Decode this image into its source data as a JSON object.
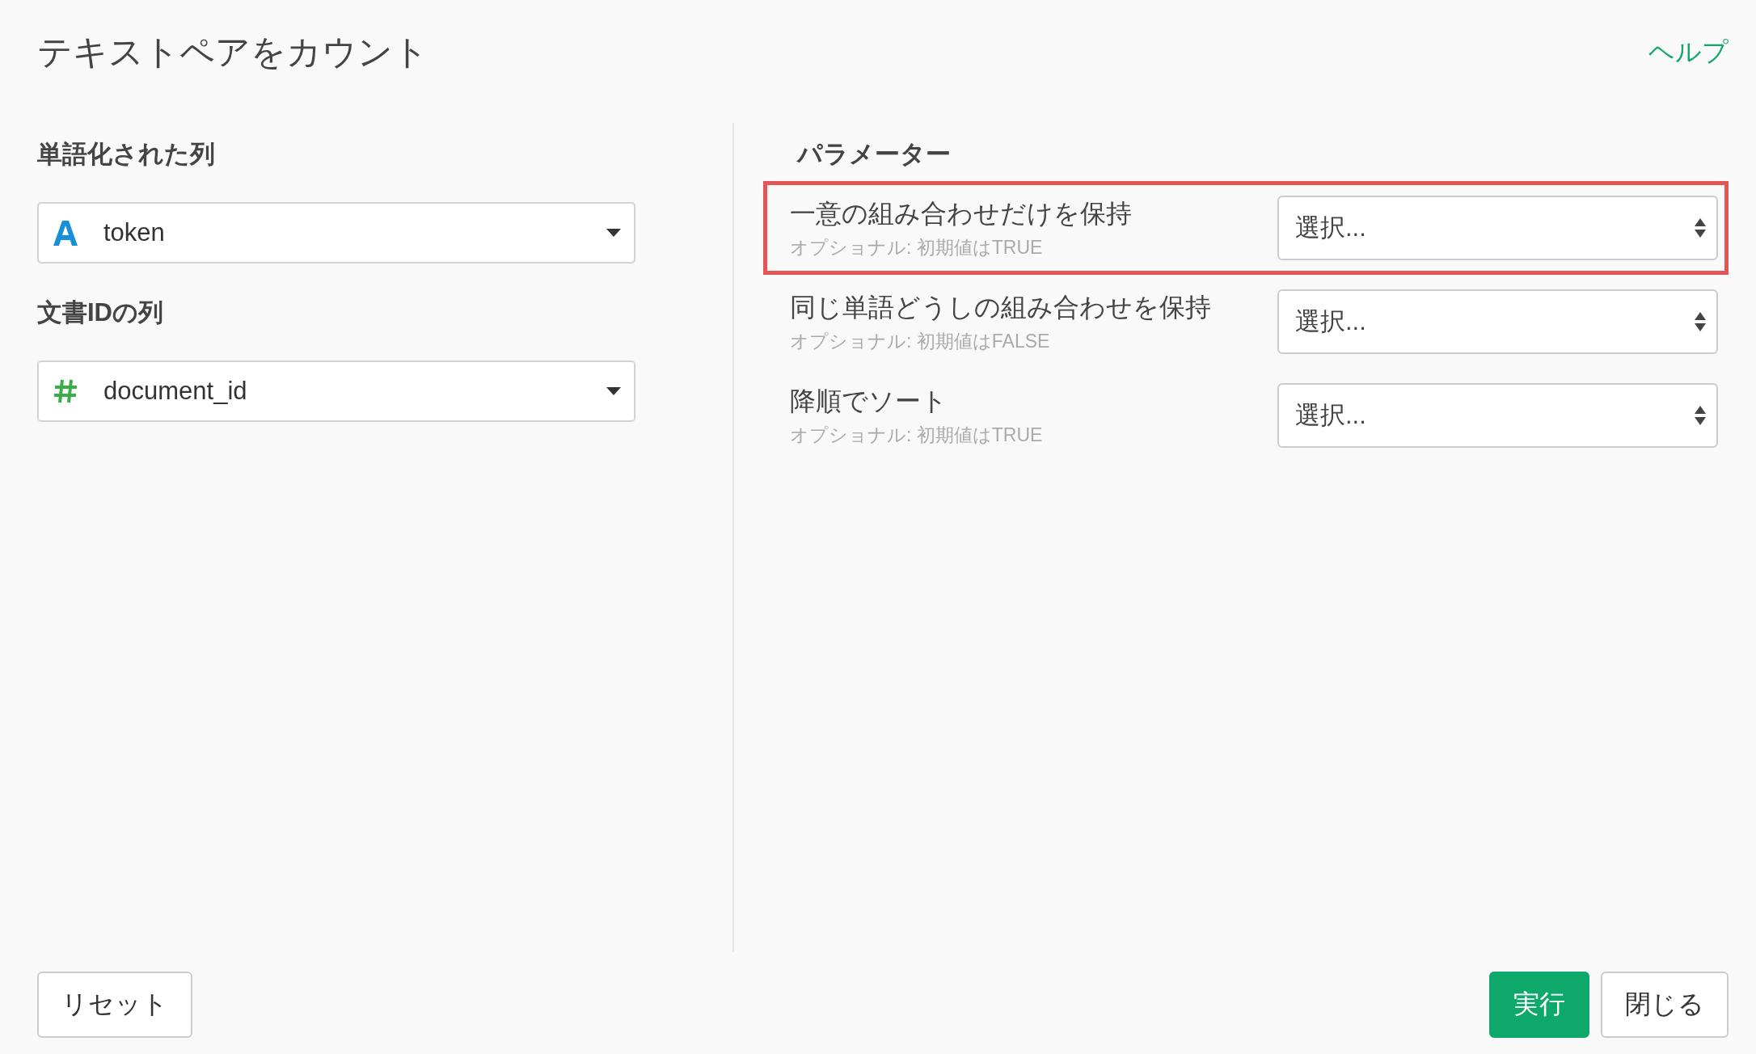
{
  "dialog": {
    "title": "テキストペアをカウント",
    "help_link": "ヘルプ"
  },
  "columns": [
    {
      "label": "単語化された列",
      "kind": "text",
      "value": "token"
    },
    {
      "label": "文書IDの列",
      "kind": "number",
      "value": "document_id"
    }
  ],
  "parameters": {
    "heading": "パラメーター",
    "items": [
      {
        "label": "一意の組み合わせだけを保持",
        "hint": "オプショナル: 初期値はTRUE",
        "placeholder": "選択...",
        "highlighted": true
      },
      {
        "label": "同じ単語どうしの組み合わせを保持",
        "hint": "オプショナル: 初期値はFALSE",
        "placeholder": "選択...",
        "highlighted": false
      },
      {
        "label": "降順でソート",
        "hint": "オプショナル: 初期値はTRUE",
        "placeholder": "選択...",
        "highlighted": false
      }
    ]
  },
  "buttons": [
    {
      "label": "リセット",
      "kind": "secondary"
    },
    {
      "label": "実行",
      "kind": "primary"
    },
    {
      "label": "閉じる",
      "kind": "secondary"
    }
  ]
}
